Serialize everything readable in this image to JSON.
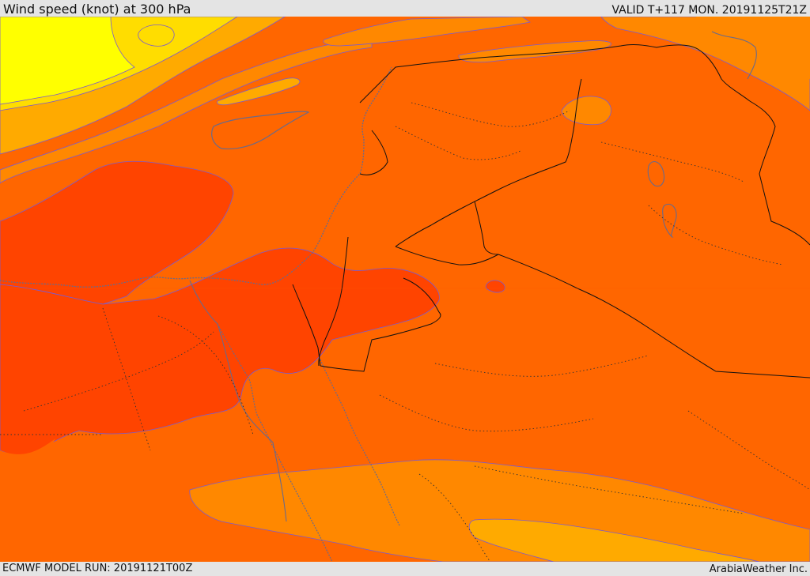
{
  "header": {
    "title": "Wind speed (knot) at 300 hPa",
    "valid": "VALID T+117 MON. 20191125T21Z"
  },
  "footer": {
    "model_run": "ECMWF MODEL RUN: 20191121T00Z",
    "credit": "ArabiaWeather Inc."
  },
  "colors": {
    "yellow_zone": "#ffff00",
    "light_orange_zone": "#ffdd00",
    "amber_zone": "#ffaa00",
    "orange_zone": "#ff8800",
    "dark_orange_zone": "#ff6600",
    "red_orange_zone": "#ff4400",
    "background_sea": "#ff6600"
  }
}
